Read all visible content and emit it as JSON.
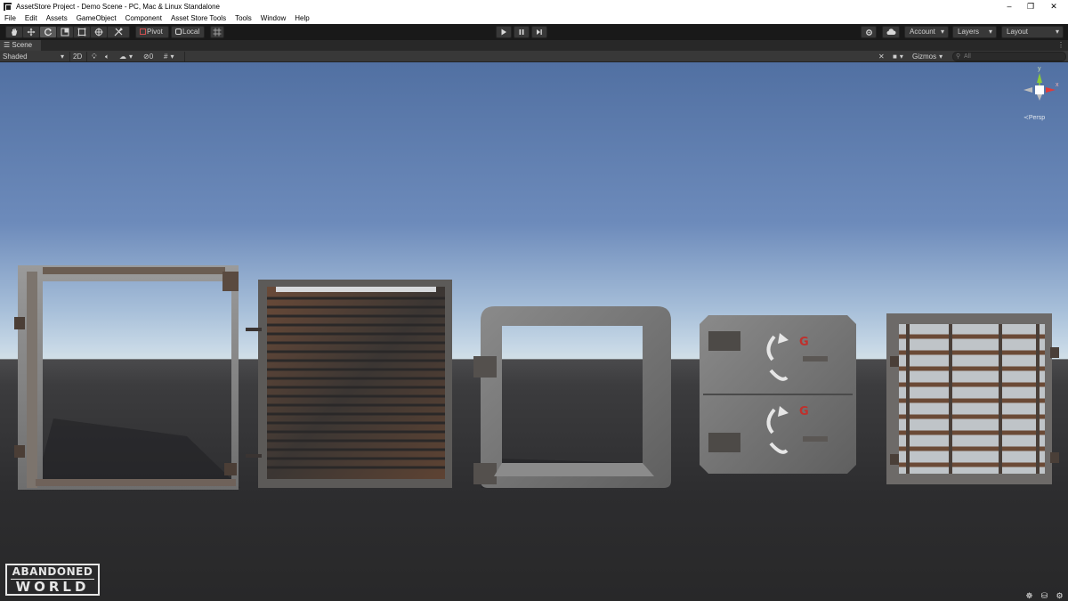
{
  "window": {
    "title": "AssetStore Project - Demo Scene - PC, Mac & Linux Standalone",
    "controls": [
      "–",
      "❐",
      "✕"
    ]
  },
  "menu": [
    "File",
    "Edit",
    "Assets",
    "GameObject",
    "Component",
    "Asset Store Tools",
    "Tools",
    "Window",
    "Help"
  ],
  "toolbar": {
    "pivot_label": "Pivot",
    "local_label": "Local",
    "account_label": "Account",
    "layers_label": "Layers",
    "layout_label": "Layout"
  },
  "scene_tab": {
    "label": "Scene"
  },
  "scene_toolbar": {
    "shading_mode": "Shaded",
    "mode_2d": "2D",
    "hidden_count": "0",
    "gizmos_label": "Gizmos",
    "search_placeholder": "All"
  },
  "view_gizmo": {
    "projection_label": "Persp",
    "axis_y_label": "y",
    "axis_x_label": "x"
  },
  "logo": {
    "line1": "ABANDONED",
    "line2": "WORLD"
  },
  "icons": {
    "tools": [
      "hand-icon",
      "move-icon",
      "rotate-icon",
      "scale-icon",
      "rect-icon",
      "transform-icon",
      "custom-tool-icon"
    ],
    "play_controls": [
      "play-icon",
      "pause-icon",
      "step-icon"
    ],
    "right": [
      "services-icon",
      "cloud-icon"
    ]
  },
  "colors": {
    "accent_selected": "#5a5a5a",
    "axis_x": "#e03a3a",
    "axis_y": "#8ccc3a"
  }
}
